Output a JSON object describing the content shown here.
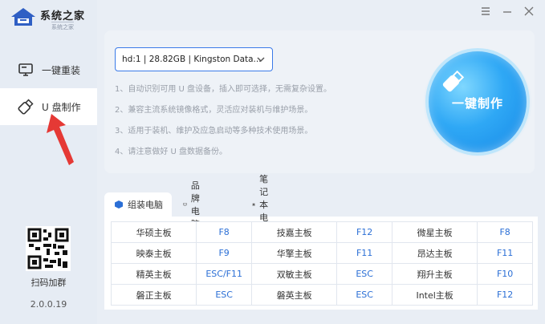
{
  "app": {
    "title": "系统之家",
    "subtitle": "系统之家",
    "version": "2.0.0.19"
  },
  "sidebar": {
    "items": [
      {
        "label": "一键重装",
        "icon": "monitor-icon",
        "active": false
      },
      {
        "label": "U 盘制作",
        "icon": "usb-drive-icon",
        "active": true
      }
    ],
    "qr_label": "扫码加群"
  },
  "device_select": {
    "value": "hd:1 | 28.82GB | Kingston Data..."
  },
  "tips": [
    "1、自动识别可用 U 盘设备，插入即可选择，无需复杂设置。",
    "2、兼容主流系统镜像格式，灵活应对装机与维护场景。",
    "3、适用于装机、维护及应急启动等多种技术使用场景。",
    "4、请注意做好 U 盘数据备份。"
  ],
  "action_button": {
    "label": "一键制作"
  },
  "tabs": [
    {
      "label": "组装电脑",
      "icon": "cube-icon",
      "active": true
    },
    {
      "label": "品牌电脑",
      "icon": "desktop-icon",
      "active": false
    },
    {
      "label": "笔记本电脑",
      "icon": "laptop-icon",
      "active": false
    }
  ],
  "hotkey_table": {
    "rows": [
      [
        {
          "name": "华硕主板",
          "key": "F8"
        },
        {
          "name": "技嘉主板",
          "key": "F12"
        },
        {
          "name": "微星主板",
          "key": "F8"
        }
      ],
      [
        {
          "name": "映泰主板",
          "key": "F9"
        },
        {
          "name": "华擎主板",
          "key": "F11"
        },
        {
          "name": "昂达主板",
          "key": "F11"
        }
      ],
      [
        {
          "name": "精英主板",
          "key": "ESC/F11"
        },
        {
          "name": "双敏主板",
          "key": "ESC"
        },
        {
          "name": "翔升主板",
          "key": "F10"
        }
      ],
      [
        {
          "name": "磐正主板",
          "key": "ESC"
        },
        {
          "name": "磐英主板",
          "key": "ESC"
        },
        {
          "name": "Intel主板",
          "key": "F12"
        }
      ]
    ]
  },
  "colors": {
    "accent": "#2b6fd6",
    "button": "#2fa8f5",
    "arrow": "#e53935"
  }
}
